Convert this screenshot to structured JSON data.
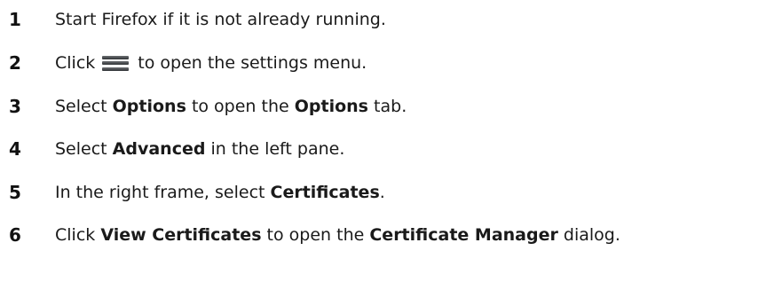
{
  "steps": [
    {
      "number": "1",
      "segments": [
        "Start Firefox if it is not already running."
      ]
    },
    {
      "number": "2",
      "before_icon": "Click",
      "icon": "hamburger-menu-icon",
      "after_icon": "to open the settings menu."
    },
    {
      "number": "3",
      "segments": [
        "Select ",
        "Options",
        " to open the ",
        "Options",
        " tab."
      ]
    },
    {
      "number": "4",
      "segments": [
        "Select ",
        "Advanced",
        " in the left pane."
      ]
    },
    {
      "number": "5",
      "segments": [
        "In the right frame, select ",
        "Certificates",
        "."
      ]
    },
    {
      "number": "6",
      "segments": [
        "Click ",
        "View Certificates",
        " to open the ",
        "Certificate Manager",
        " dialog."
      ]
    }
  ]
}
